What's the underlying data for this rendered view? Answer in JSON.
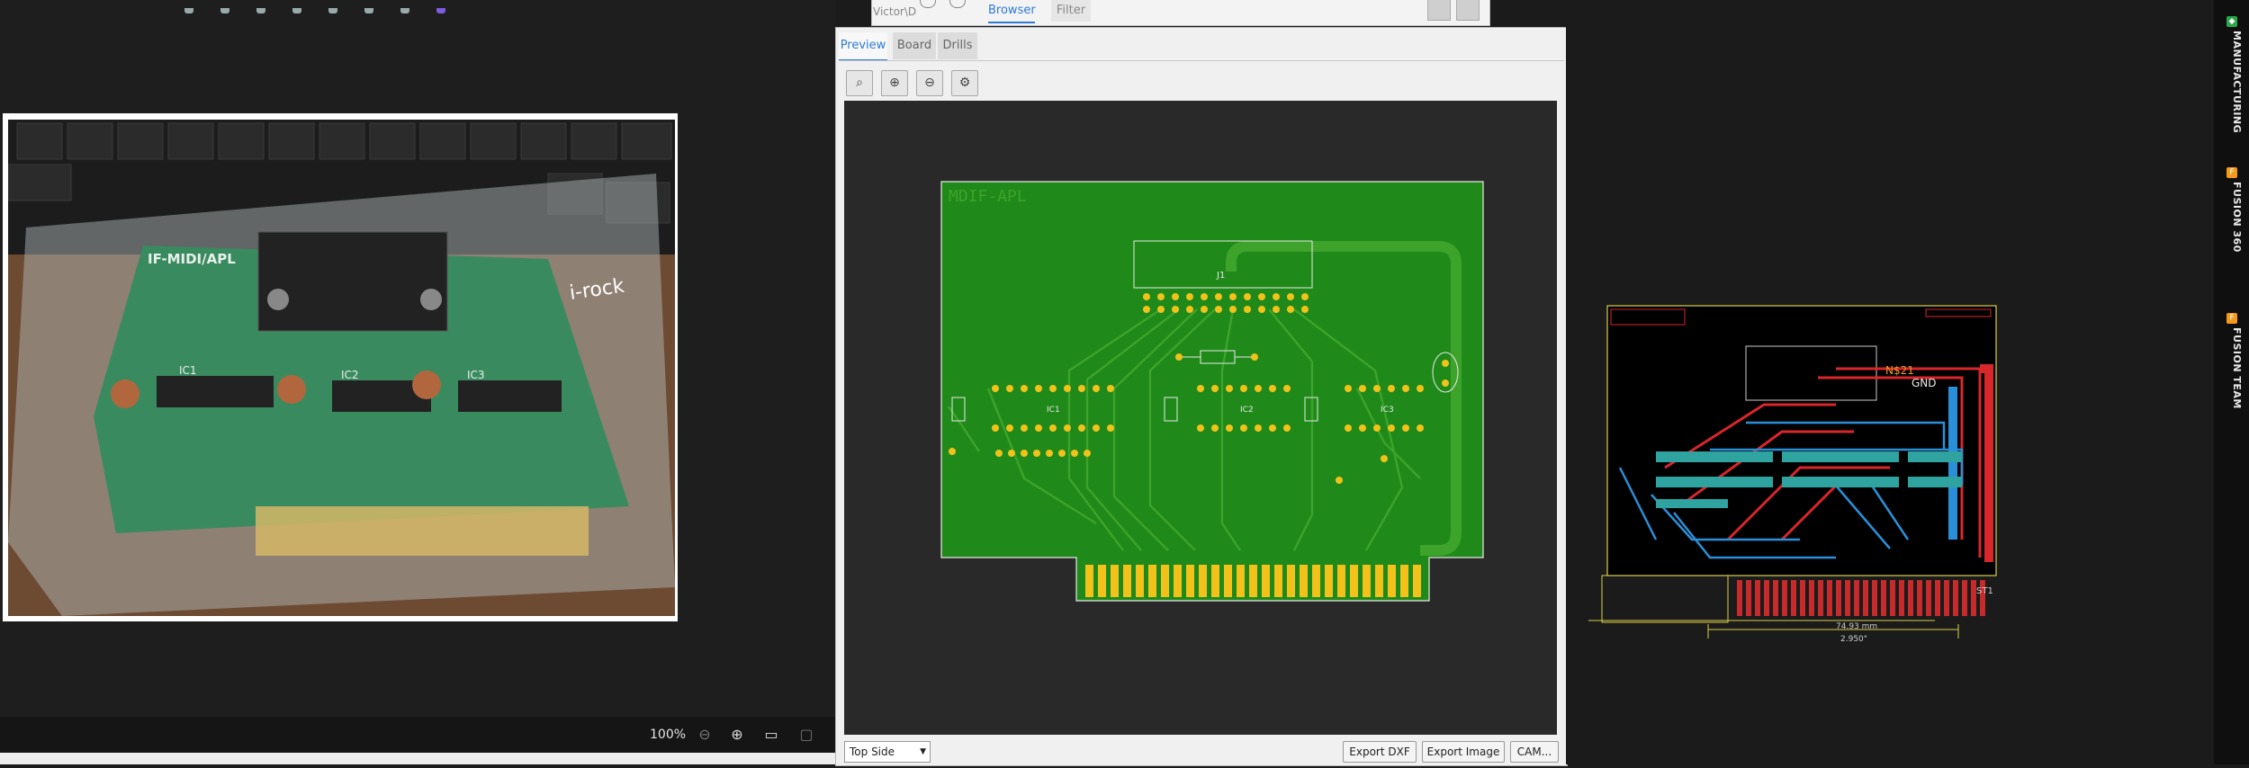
{
  "viewer": {
    "zoom": "100%",
    "photo_caption_visible": false,
    "board_silkscreen": {
      "title": "IF-MIDI/APL",
      "ic_labels": [
        "IC1",
        "IC2",
        "IC3"
      ],
      "brand": "i-rock"
    }
  },
  "browser_header": {
    "path_text": "Victor\\D",
    "tabs": [
      {
        "label": "Browser",
        "active": true
      },
      {
        "label": "Filter",
        "active": false
      }
    ]
  },
  "manufacturing": {
    "tabs": [
      {
        "label": "Preview",
        "active": true
      },
      {
        "label": "Board",
        "active": false
      },
      {
        "label": "Drills",
        "active": false
      }
    ],
    "toolbar_icons": [
      "zoom-fit-icon",
      "zoom-in-icon",
      "zoom-out-icon",
      "settings-icon"
    ],
    "layer_select": {
      "value": "Top Side"
    },
    "buttons": {
      "export_dxf": "Export DXF",
      "export_image": "Export Image",
      "cam": "CAM..."
    },
    "pcb": {
      "title": "MDIF-APL",
      "connector_label": "J1",
      "ic_labels": [
        "IC1",
        "IC2",
        "IC3"
      ],
      "colors": {
        "board": "#1f8a1a",
        "pads": "#f2c21b",
        "trace": "#3ea32a"
      }
    }
  },
  "board_view": {
    "net_labels": [
      "N$21",
      "GND"
    ],
    "part_label": "ST1",
    "dimension_mm": "74.93 mm",
    "dimension_in": "2.950\"",
    "colors": {
      "top": "#d8262b",
      "bottom": "#2a8fd8",
      "outline": "#d8d04a"
    }
  },
  "side_panel": {
    "tabs": [
      {
        "label": "MANUFACTURING",
        "badge_color": "#2aa84a"
      },
      {
        "label": "FUSION 360",
        "badge_color": "#f39a1a"
      },
      {
        "label": "FUSION TEAM",
        "badge_color": "#f39a1a"
      }
    ]
  }
}
